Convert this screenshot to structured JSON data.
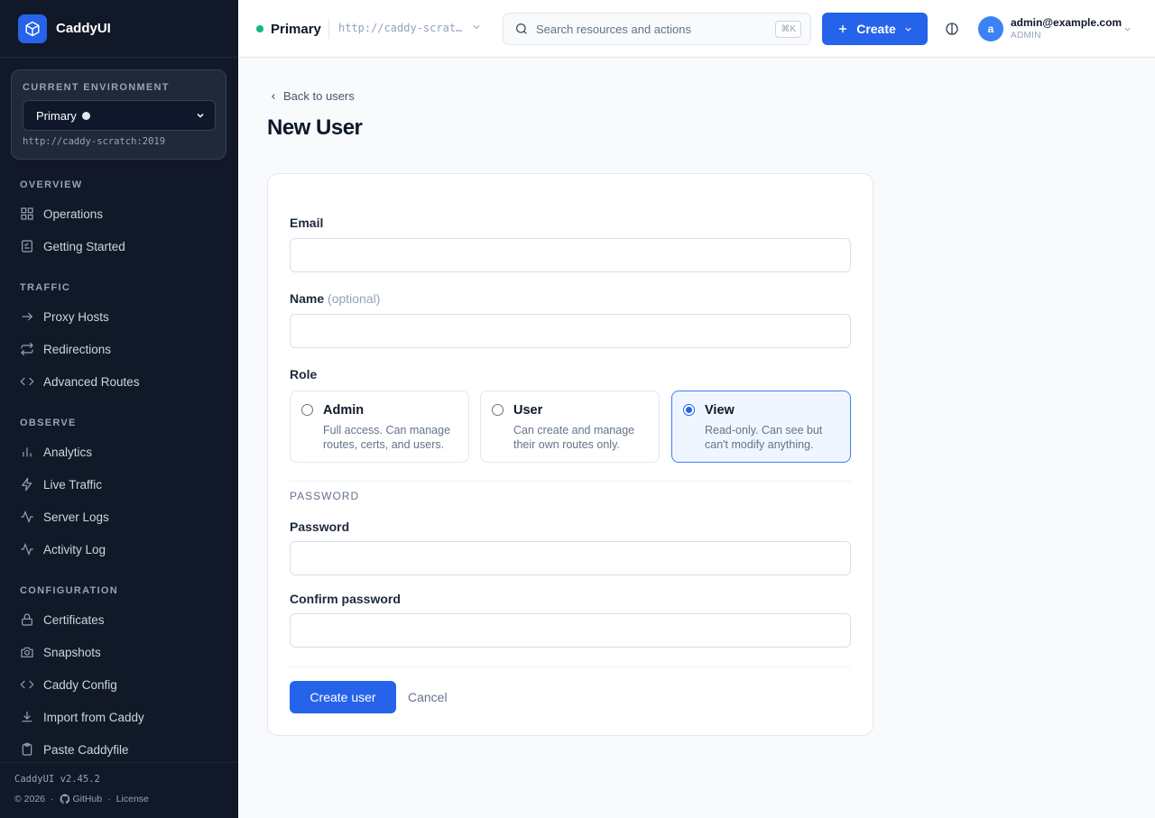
{
  "brand": {
    "name": "CaddyUI"
  },
  "sidebar": {
    "env_label": "CURRENT ENVIRONMENT",
    "env_selected": "Primary",
    "env_url": "http://caddy-scratch:2019",
    "sections": {
      "overview": "OVERVIEW",
      "traffic": "TRAFFIC",
      "observe": "OBSERVE",
      "configuration": "CONFIGURATION"
    },
    "items": {
      "operations": "Operations",
      "getting_started": "Getting Started",
      "proxy_hosts": "Proxy Hosts",
      "redirections": "Redirections",
      "advanced_routes": "Advanced Routes",
      "analytics": "Analytics",
      "live_traffic": "Live Traffic",
      "server_logs": "Server Logs",
      "activity_log": "Activity Log",
      "certificates": "Certificates",
      "snapshots": "Snapshots",
      "caddy_config": "Caddy Config",
      "import_caddy": "Import from Caddy",
      "paste_caddyfile": "Paste Caddyfile"
    },
    "version": "CaddyUI v2.45.2",
    "copyright": "© 2026",
    "github": "GitHub",
    "license": "License"
  },
  "topbar": {
    "env_name": "Primary",
    "env_url": "http://caddy-scrat…",
    "search_placeholder": "Search resources and actions",
    "search_shortcut": "⌘K",
    "create_label": "Create",
    "user_email": "admin@example.com",
    "user_role": "ADMIN",
    "avatar_initial": "a"
  },
  "page": {
    "back_label": "Back to users",
    "title": "New User"
  },
  "form": {
    "email_label": "Email",
    "name_label": "Name",
    "name_optional": "(optional)",
    "role_label": "Role",
    "roles": [
      {
        "title": "Admin",
        "desc": "Full access. Can manage routes, certs, and users.",
        "selected": false
      },
      {
        "title": "User",
        "desc": "Can create and manage their own routes only.",
        "selected": false
      },
      {
        "title": "View",
        "desc": "Read-only. Can see but can't modify anything.",
        "selected": true
      }
    ],
    "password_section": "PASSWORD",
    "password_label": "Password",
    "confirm_label": "Confirm password",
    "submit_label": "Create user",
    "cancel_label": "Cancel"
  },
  "colors": {
    "accent": "#2563eb",
    "sidebar_bg": "#111827",
    "env_status": "#10b981"
  }
}
